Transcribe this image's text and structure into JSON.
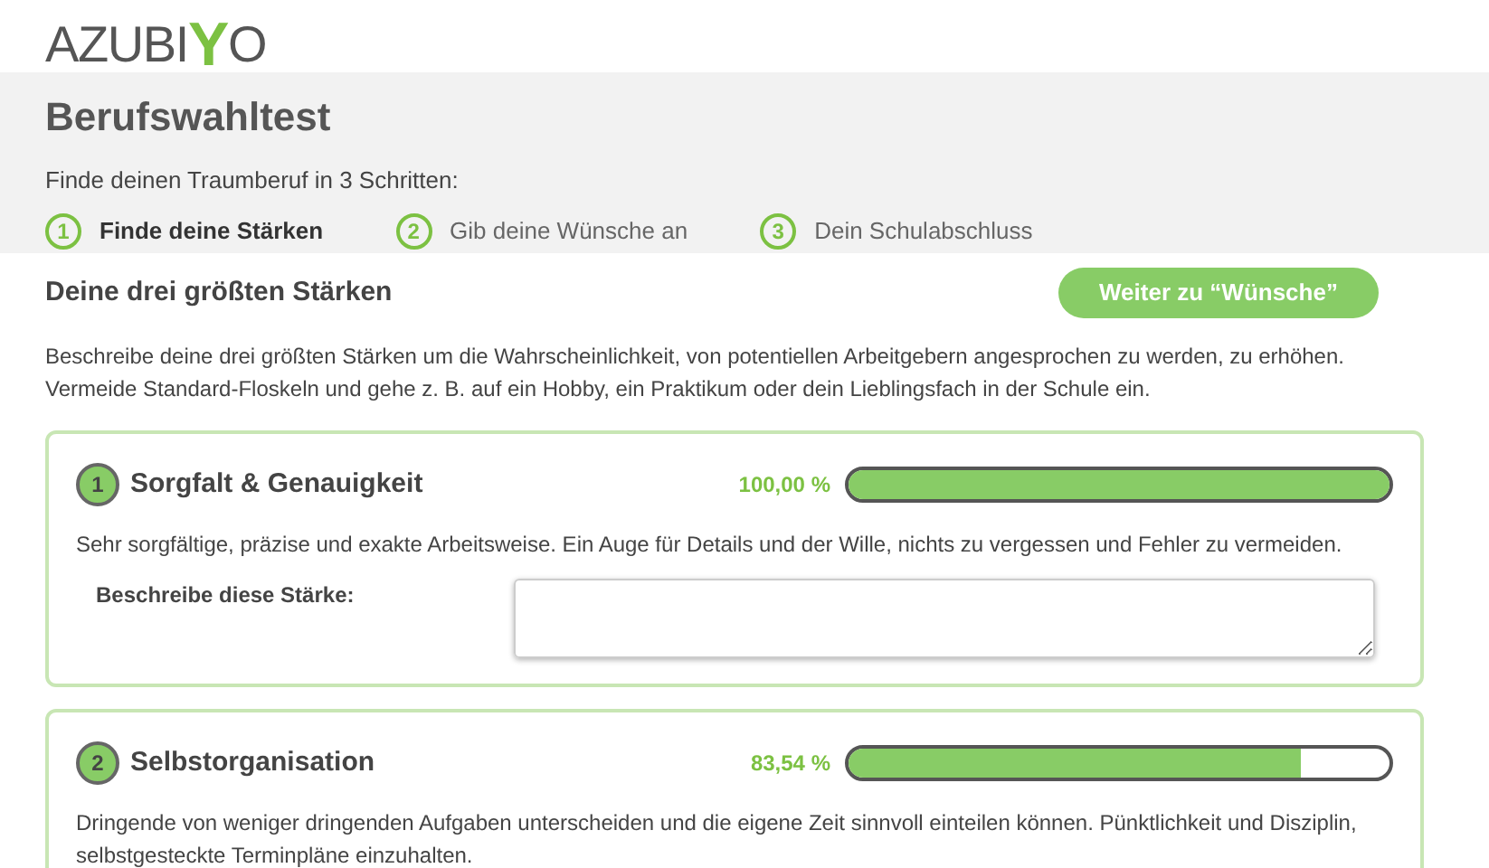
{
  "logo": {
    "text_before": "AZUBI",
    "mark": "Y",
    "text_after": "O"
  },
  "header": {
    "title": "Berufswahltest",
    "subtitle": "Finde deinen Traumberuf in 3 Schritten:"
  },
  "steps": [
    {
      "number": "1",
      "label": "Finde deine Stärken",
      "selected": true
    },
    {
      "number": "2",
      "label": "Gib deine Wünsche an",
      "selected": false
    },
    {
      "number": "3",
      "label": "Dein Schulabschluss",
      "selected": false
    }
  ],
  "section": {
    "title": "Deine drei größten Stärken",
    "next_button": "Weiter zu “Wünsche”",
    "intro": "Beschreibe deine drei größten Stärken um die Wahrscheinlichkeit, von potentiellen Arbeitgebern angesprochen zu werden, zu erhöhen. Vermeide Standard-Floskeln und gehe z. B. auf ein Hobby, ein Praktikum oder dein Lieblingsfach in der Schule ein."
  },
  "strengths": [
    {
      "number": "1",
      "name": "Sorgfalt & Genauigkeit",
      "percent": "100,00 %",
      "level": 1.0,
      "description": "Sehr sorgfältige, präzise und exakte Arbeitsweise. Ein Auge für Details und der Wille, nichts zu vergessen und Fehler zu vermeiden.",
      "field_label": "Beschreibe diese Stärke:"
    },
    {
      "number": "2",
      "name": "Selbstorganisation",
      "percent": "83,54 %",
      "level": 0.8354,
      "description": "Dringende von weniger dringenden Aufgaben unterscheiden und die eigene Zeit sinnvoll einteilen können. Pünktlichkeit und Disziplin, selbstgesteckte Terminpläne einzuhalten."
    }
  ]
}
